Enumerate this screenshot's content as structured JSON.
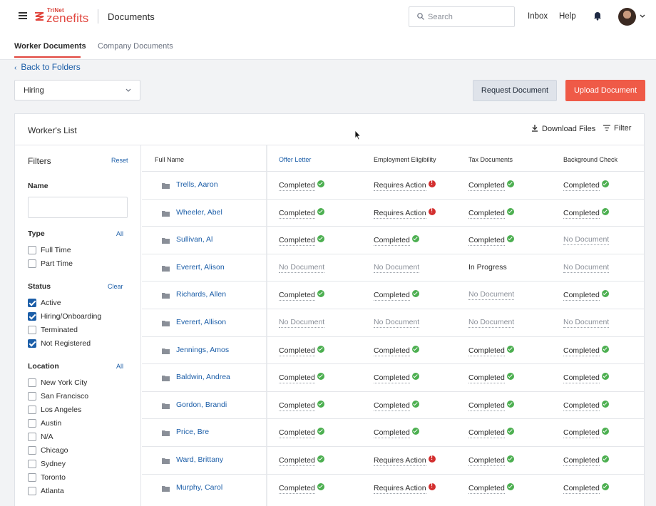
{
  "header": {
    "brand_top": "TriNet",
    "brand_main": "zenefits",
    "app_title": "Documents",
    "search_placeholder": "Search",
    "inbox_label": "Inbox",
    "help_label": "Help"
  },
  "tabs": [
    {
      "label": "Worker Documents",
      "active": true
    },
    {
      "label": "Company Documents",
      "active": false
    }
  ],
  "back_link": "Back to Folders",
  "folder_select": {
    "value": "Hiring"
  },
  "actions": {
    "request_label": "Request Document",
    "upload_label": "Upload Document"
  },
  "card": {
    "title": "Worker's List",
    "download_label": "Download Files",
    "filter_label": "Filter"
  },
  "filters": {
    "title": "Filters",
    "reset_label": "Reset",
    "name_heading": "Name",
    "name_value": "",
    "type": {
      "heading": "Type",
      "link": "All",
      "options": [
        {
          "label": "Full Time",
          "checked": false
        },
        {
          "label": "Part Time",
          "checked": false
        }
      ]
    },
    "status": {
      "heading": "Status",
      "link": "Clear",
      "options": [
        {
          "label": "Active",
          "checked": true
        },
        {
          "label": "Hiring/Onboarding",
          "checked": true
        },
        {
          "label": "Terminated",
          "checked": false
        },
        {
          "label": "Not Registered",
          "checked": true
        }
      ]
    },
    "location": {
      "heading": "Location",
      "link": "All",
      "options": [
        {
          "label": "New York City",
          "checked": false
        },
        {
          "label": "San Francisco",
          "checked": false
        },
        {
          "label": "Los Angeles",
          "checked": false
        },
        {
          "label": "Austin",
          "checked": false
        },
        {
          "label": "N/A",
          "checked": false
        },
        {
          "label": "Chicago",
          "checked": false
        },
        {
          "label": "Sydney",
          "checked": false
        },
        {
          "label": "Toronto",
          "checked": false
        },
        {
          "label": "Atlanta",
          "checked": false
        }
      ]
    }
  },
  "table": {
    "columns": [
      "Full Name",
      "Offer Letter",
      "Employment Eligibility",
      "Tax Documents",
      "Background Check"
    ],
    "rows": [
      {
        "name": "Trells, Aaron",
        "cells": [
          "Completed",
          "Requires Action",
          "Completed",
          "Completed"
        ]
      },
      {
        "name": "Wheeler, Abel",
        "cells": [
          "Completed",
          "Requires Action",
          "Completed",
          "Completed"
        ]
      },
      {
        "name": "Sullivan, Al",
        "cells": [
          "Completed",
          "Completed",
          "Completed",
          "No Document"
        ]
      },
      {
        "name": "Everert, Alison",
        "cells": [
          "No Document",
          "No Document",
          "In Progress",
          "No Document"
        ]
      },
      {
        "name": "Richards, Allen",
        "cells": [
          "Completed",
          "Completed",
          "No Document",
          "Completed"
        ]
      },
      {
        "name": "Everert, Allison",
        "cells": [
          "No Document",
          "No Document",
          "No Document",
          "No Document"
        ]
      },
      {
        "name": "Jennings, Amos",
        "cells": [
          "Completed",
          "Completed",
          "Completed",
          "Completed"
        ]
      },
      {
        "name": "Baldwin, Andrea",
        "cells": [
          "Completed",
          "Completed",
          "Completed",
          "Completed"
        ]
      },
      {
        "name": "Gordon, Brandi",
        "cells": [
          "Completed",
          "Completed",
          "Completed",
          "Completed"
        ]
      },
      {
        "name": "Price, Bre",
        "cells": [
          "Completed",
          "Completed",
          "Completed",
          "Completed"
        ]
      },
      {
        "name": "Ward, Brittany",
        "cells": [
          "Completed",
          "Requires Action",
          "Completed",
          "Completed"
        ]
      },
      {
        "name": "Murphy, Carol",
        "cells": [
          "Completed",
          "Requires Action",
          "Completed",
          "Completed"
        ]
      }
    ]
  },
  "colors": {
    "brand": "#e1463e",
    "link": "#1c5ea8",
    "success": "#4caf50",
    "alert": "#d32f2f"
  }
}
